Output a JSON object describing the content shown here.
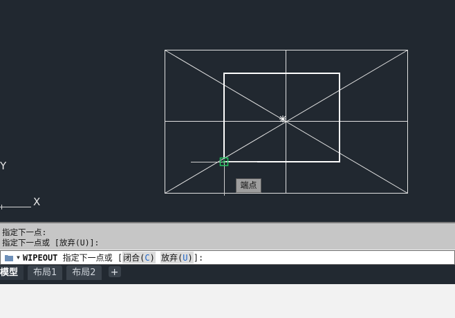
{
  "viewport": {
    "ucs_x_label": "X",
    "ucs_y_label": "Y",
    "tooltip": "端点",
    "colors": {
      "background": "#212830",
      "lines": "#e8e8e8",
      "snap_marker": "#22c55e"
    }
  },
  "history": {
    "lines": [
      "指定下一点:",
      "指定下一点或 [放弃(U)]:"
    ]
  },
  "command_line": {
    "command_name": "WIPEOUT",
    "prompt_text": "指定下一点或 [",
    "option1_label": "闭合(",
    "option1_key": "C",
    "option1_close": ")",
    "option2_label": "放弃(",
    "option2_key": "U",
    "option2_close": ")",
    "prompt_end": "]:"
  },
  "tabs": {
    "items": [
      "模型",
      "布局1",
      "布局2"
    ],
    "add_label": "+"
  }
}
